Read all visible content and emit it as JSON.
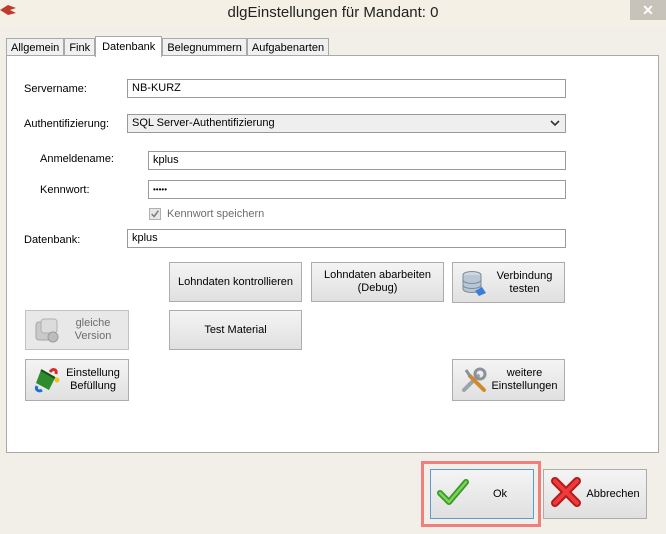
{
  "window": {
    "title": "dlgEinstellungen für Mandant: 0"
  },
  "tabs": [
    "Allgemein",
    "Fink",
    "Datenbank",
    "Belegnummern",
    "Aufgabenarten"
  ],
  "form": {
    "servername_label": "Servername:",
    "servername_value": "NB-KURZ",
    "auth_label": "Authentifizierung:",
    "auth_value": "SQL Server-Authentifizierung",
    "login_label": "Anmeldename:",
    "login_value": "kplus",
    "password_label": "Kennwort:",
    "password_value": "•••••",
    "save_password_label": "Kennwort speichern",
    "database_label": "Datenbank:",
    "database_value": "kplus"
  },
  "buttons": {
    "lohndaten_kontrollieren": "Lohndaten kontrollieren",
    "lohndaten_abarbeiten": "Lohndaten abarbeiten (Debug)",
    "verbindung_testen": "Verbindung testen",
    "gleiche_version": "gleiche Version",
    "test_material": "Test Material",
    "einstellung_befuellung": "Einstellung Befüllung",
    "weitere_einstellungen": "weitere Einstellungen",
    "ok": "Ok",
    "abbrechen": "Abbrechen"
  }
}
